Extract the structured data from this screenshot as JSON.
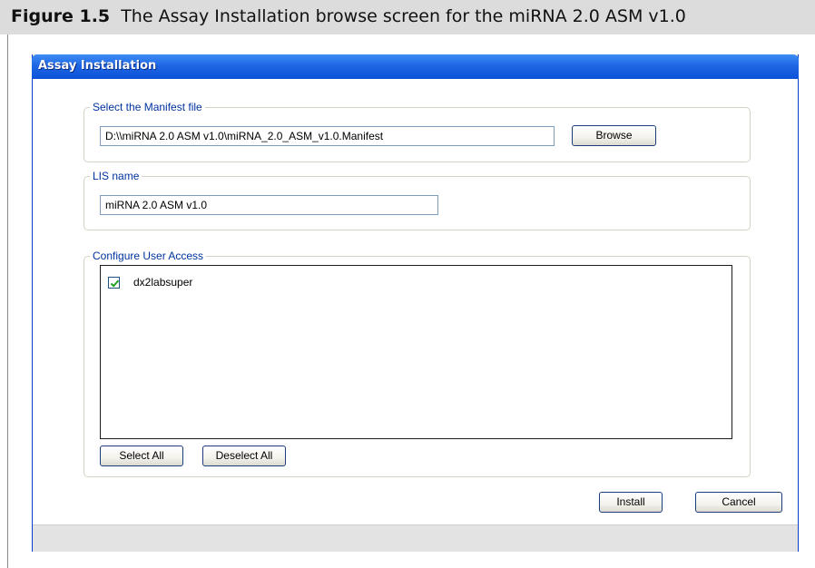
{
  "figure": {
    "label": "Figure 1.5",
    "caption": "The Assay Installation browse screen for the miRNA 2.0 ASM v1.0"
  },
  "window": {
    "title": "Assay Installation"
  },
  "manifest_group": {
    "legend": "Select the Manifest file",
    "path_value": "D:\\\\miRNA 2.0 ASM v1.0\\miRNA_2.0_ASM_v1.0.Manifest",
    "browse_label": "Browse"
  },
  "lis_group": {
    "legend": "LIS name",
    "name_value": "miRNA 2.0 ASM v1.0"
  },
  "access_group": {
    "legend": "Configure User Access",
    "users": [
      {
        "name": "dx2labsuper",
        "checked": true
      }
    ],
    "select_all_label": "Select All",
    "deselect_all_label": "Deselect All"
  },
  "actions": {
    "install_label": "Install",
    "cancel_label": "Cancel"
  },
  "colors": {
    "titlebar": "#1f66e4",
    "legend_text": "#0033a0",
    "checkmark": "#21a121"
  }
}
